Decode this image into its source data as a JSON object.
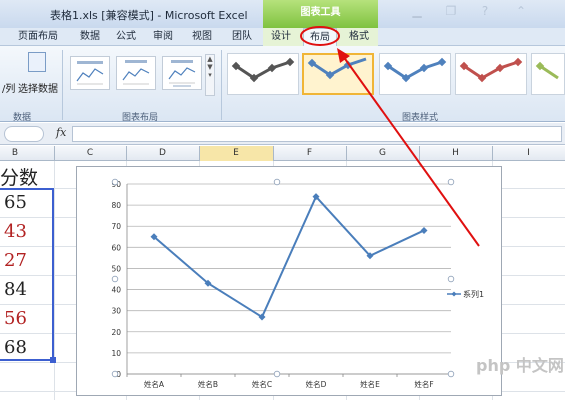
{
  "window": {
    "title": "表格1.xls [兼容模式] - Microsoft Excel",
    "context_tab_group": "图表工具"
  },
  "tabs": [
    "页面布局",
    "数据",
    "公式",
    "审阅",
    "视图",
    "团队",
    "设计",
    "布局",
    "格式"
  ],
  "ribbon": {
    "data_group": {
      "buttons": [
        "/列",
        "选择数据"
      ],
      "label": "数据"
    },
    "layout_group": {
      "label": "图表布局"
    },
    "style_group": {
      "label": "图表样式",
      "colors": [
        "#555555",
        "#4f81bd",
        "#4f81bd",
        "#c0504d",
        "#9bbb59"
      ]
    }
  },
  "formula_bar": {
    "fx": "fx",
    "value": ""
  },
  "columns": [
    "B",
    "C",
    "D",
    "E",
    "F",
    "G",
    "H",
    "I"
  ],
  "sheet": {
    "header": "分数",
    "values": [
      "65",
      "43",
      "27",
      "84",
      "56",
      "68"
    ],
    "value_colors": [
      "#222222",
      "#b22222",
      "#b22222",
      "#222222",
      "#b22222",
      "#222222"
    ]
  },
  "chart_data": {
    "type": "line",
    "categories": [
      "姓名A",
      "姓名B",
      "姓名C",
      "姓名D",
      "姓名E",
      "姓名F"
    ],
    "series": [
      {
        "name": "系列1",
        "values": [
          65,
          43,
          27,
          84,
          56,
          68
        ]
      }
    ],
    "ylim": [
      0,
      90
    ],
    "yticks": [
      "0",
      "10",
      "20",
      "30",
      "40",
      "50",
      "60",
      "70",
      "80",
      "90"
    ],
    "grid": true,
    "legend": "right",
    "color": "#4a7ebb"
  },
  "watermark": "php 中文网"
}
